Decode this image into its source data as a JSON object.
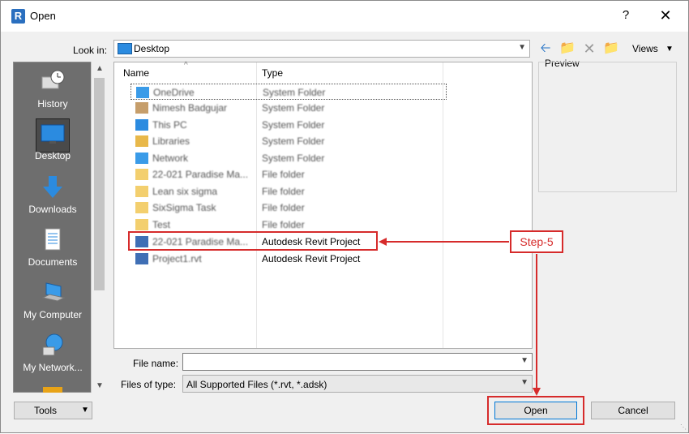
{
  "window": {
    "title": "Open",
    "app_icon_letter": "R",
    "help": "?",
    "close": "✕"
  },
  "lookin": {
    "label": "Look in:",
    "value": "Desktop"
  },
  "toolbar": {
    "views_label": "Views"
  },
  "places": [
    {
      "label": "History",
      "icon": "history-icon"
    },
    {
      "label": "Desktop",
      "icon": "desktop-icon"
    },
    {
      "label": "Downloads",
      "icon": "downloads-icon"
    },
    {
      "label": "Documents",
      "icon": "documents-icon"
    },
    {
      "label": "My Computer",
      "icon": "computer-icon"
    },
    {
      "label": "My Network...",
      "icon": "network-icon"
    }
  ],
  "filelist": {
    "columns": {
      "name": "Name",
      "type": "Type"
    },
    "rows": [
      {
        "name": "OneDrive",
        "type": "System Folder"
      },
      {
        "name": "Nimesh Badgujar",
        "type": "System Folder"
      },
      {
        "name": "This PC",
        "type": "System Folder"
      },
      {
        "name": "Libraries",
        "type": "System Folder"
      },
      {
        "name": "Network",
        "type": "System Folder"
      },
      {
        "name": "22-021 Paradise Ma...",
        "type": "File folder"
      },
      {
        "name": "Lean six sigma",
        "type": "File folder"
      },
      {
        "name": "SixSigma Task",
        "type": "File folder"
      },
      {
        "name": "Test",
        "type": "File folder"
      },
      {
        "name": "22-021 Paradise Ma...",
        "type": "Autodesk Revit Project"
      },
      {
        "name": "Project1.rvt",
        "type": "Autodesk Revit Project"
      }
    ]
  },
  "preview": {
    "label": "Preview"
  },
  "filename": {
    "label": "File name:",
    "value": ""
  },
  "filetype": {
    "label": "Files of type:",
    "value": "All Supported Files  (*.rvt, *.adsk)"
  },
  "buttons": {
    "tools": "Tools",
    "open": "Open",
    "cancel": "Cancel"
  },
  "annotation": {
    "step": "Step-5",
    "color": "#d62b2b"
  }
}
